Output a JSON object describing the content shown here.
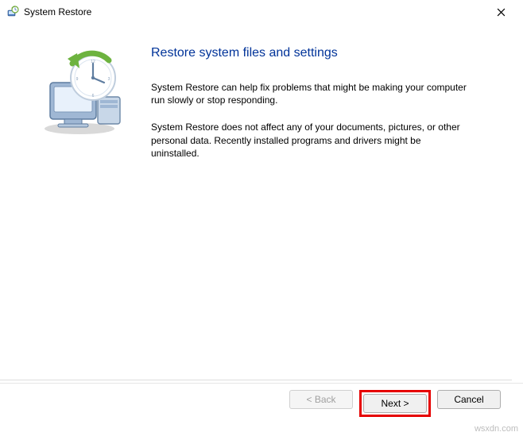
{
  "window": {
    "title": "System Restore"
  },
  "main": {
    "heading": "Restore system files and settings",
    "para1": "System Restore can help fix problems that might be making your computer run slowly or stop responding.",
    "para2": "System Restore does not affect any of your documents, pictures, or other personal data. Recently installed programs and drivers might be uninstalled."
  },
  "footer": {
    "back": "< Back",
    "next": "Next >",
    "cancel": "Cancel"
  },
  "watermark": "wsxdn.com"
}
